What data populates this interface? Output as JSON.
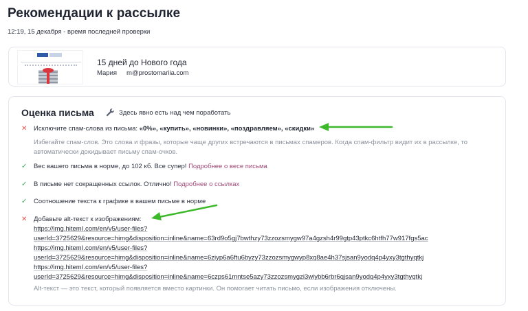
{
  "page": {
    "title": "Рекомендации к рассылке",
    "last_check": "12:19, 15 декабря - время последней проверки"
  },
  "campaign": {
    "subject": "15 дней до Нового года",
    "sender_name": "Мария",
    "sender_email": "m@prostomariia.com",
    "thumbnail_icon": "email-preview-image"
  },
  "evaluation": {
    "title": "Оценка письма",
    "summary_icon": "wrench-icon",
    "summary": "Здесь явно есть над чем поработать",
    "items": [
      {
        "status": "error",
        "text": "Исключите спам-слова из письма:",
        "words": "«0%», «купить», «новинки», «поздравляем», «скидки»",
        "description_1": "Избегайте спам-слов. Это слова и фразы, которые чаще других встречаются в письмах спамеров. Когда спам-фильтр видит их в рассылке, то",
        "description_2": "автоматически докидывает письму спам-очков."
      },
      {
        "status": "ok",
        "text": "Вес вашего письма в норме, до 102 кб. Все супер!",
        "link": "Подробнее о весе письма"
      },
      {
        "status": "ok",
        "text": "В письме нет сокращенных ссылок. Отлично!",
        "link": "Подробнее о ссылках"
      },
      {
        "status": "ok",
        "text": "Соотношение текста к графике в вашем письме в норме"
      },
      {
        "status": "error",
        "text": "Добавьте alt-текст к изображениям:",
        "urls": [
          "https://img.hitemI.com/en/v5/user-files?",
          "userId=3725629&resource=himg&disposition=inline&name=63rd9o5gj7bwthzy73zzozsmygw97a4gzsh4r99gtp43ptkc6htfh77w917fgs5ac",
          "https://img.hitemI.com/en/v5/user-files?",
          "userId=3725629&resource=himg&disposition=inline&name=6ziyp6a6ftu6byzy73zzozsmygwyp8xq8ae4h37sjsan9yodq4p4yxy3tgthyqtkj",
          "https://img.hitemI.com/en/v5/user-files?",
          "userId=3725629&resource=himg&disposition=inline&name=6czps61mntse5azy73zzozsmygzi3wiybb6rbr6qjsan9yodq4p4yxy3tgthyqtkj"
        ],
        "note": "Alt-текст — это текст, который появляется вместо картинки. Он помогает читать письмо, если изображения отключены."
      }
    ]
  },
  "colors": {
    "error": "#e0524a",
    "ok": "#3aaa55",
    "link": "#a04a78",
    "arrow": "#3db82a"
  },
  "status_icons": {
    "error": "cross-icon",
    "ok": "checkmark-icon"
  }
}
